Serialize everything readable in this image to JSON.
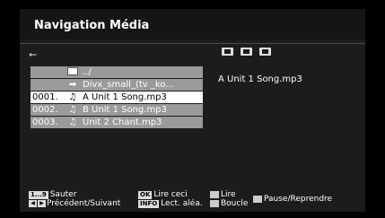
{
  "header": {
    "title": "Navigation Média"
  },
  "list": {
    "rows": [
      {
        "num": "",
        "icon": "folder-icon",
        "label": "../",
        "selected": false
      },
      {
        "num": "",
        "icon": "arrow-icon",
        "label": "Divx_small_(tv _ko...",
        "selected": false
      },
      {
        "num": "0001.",
        "icon": "music-note-icon",
        "label": "A Unit 1 Song.mp3",
        "selected": true
      },
      {
        "num": "0002.",
        "icon": "music-note-icon",
        "label": "B  Unit 1 Song.mp3",
        "selected": false
      },
      {
        "num": "0003.",
        "icon": "music-note-icon",
        "label": "Unit 2 Chant.mp3",
        "selected": false
      }
    ]
  },
  "preview": {
    "filename": "A Unit 1 Song.mp3"
  },
  "footer": {
    "jump_key": "1...9",
    "jump_label": "Sauter",
    "prevnext_label": "Précédent/Suivant",
    "ok_key": "OK",
    "play_label": "Lire ceci",
    "info_key": "INFO",
    "random_label": "Lect. aléa.",
    "play2_label": "Lire",
    "loop_label": "Boucle",
    "pause_label": "Pause/Reprendre"
  },
  "colors": {
    "row_bg": "#9a9a9a",
    "row_selected_bg": "#ffffff",
    "panel_bg": "#1c1c1c"
  }
}
